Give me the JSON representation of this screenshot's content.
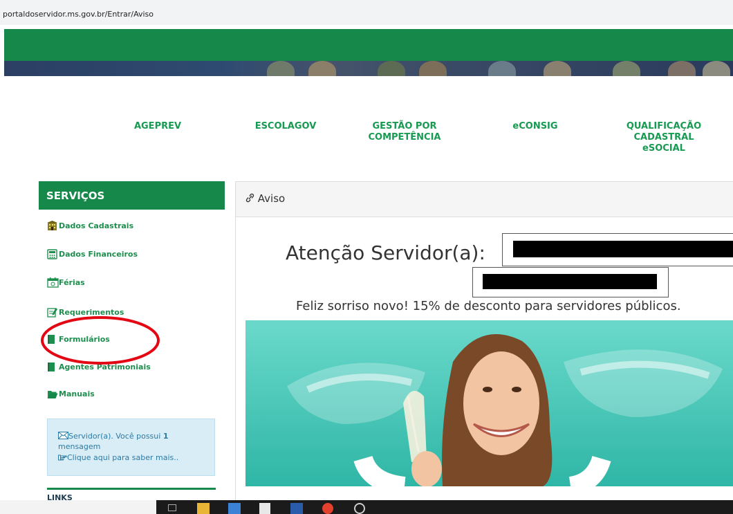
{
  "browser": {
    "url": "portaldoservidor.ms.gov.br/Entrar/Aviso"
  },
  "nav": {
    "items": [
      {
        "label": "AGEPREV"
      },
      {
        "label": "ESCOLAGOV"
      },
      {
        "label": "GESTÃO POR\nCOMPETÊNCIA"
      },
      {
        "label": "eCONSIG"
      },
      {
        "label": "QUALIFICAÇÃO\nCADASTRAL\neSOCIAL"
      }
    ]
  },
  "sidebar": {
    "title": "SERVIÇOS",
    "items": [
      {
        "label": "Dados Cadastrais",
        "icon": "building-icon"
      },
      {
        "label": "Dados Financeiros",
        "icon": "calculator-icon"
      },
      {
        "label": "Férias",
        "icon": "calendar-icon"
      },
      {
        "label": "Requerimentos",
        "icon": "edit-document-icon"
      },
      {
        "label": "Formulários",
        "icon": "book-icon"
      },
      {
        "label": "Agentes Patrimoniais",
        "icon": "book-icon"
      },
      {
        "label": "Manuais",
        "icon": "folder-open-icon"
      }
    ],
    "message": {
      "text_before": "Servidor(a). Você possui ",
      "count": "1",
      "text_after": " mensagem",
      "link": "Clique aqui para saber mais.."
    },
    "links_title": "LINKS"
  },
  "main": {
    "panel_title": "Aviso",
    "attention": "Atenção Servidor(a):",
    "promo_text": "Feliz sorriso novo! 15% de desconto para servidores públicos."
  },
  "colors": {
    "brand_green": "#16894a",
    "nav_green": "#179a52",
    "info_bg": "#d9edf6",
    "ad_teal": "#3cc7b7",
    "annotation_red": "#e30613"
  }
}
